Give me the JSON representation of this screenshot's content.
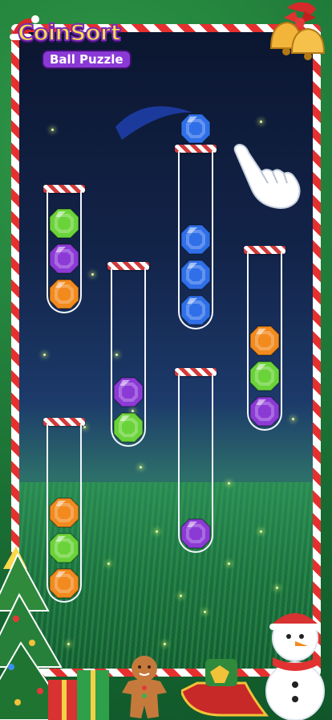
{
  "game": {
    "logo_title": "CoinSort",
    "logo_subtitle": "Ball Puzzle"
  },
  "colors": {
    "green_gem": "#6bd33a",
    "purple_gem": "#8c3ad6",
    "orange_gem": "#f28a1e",
    "blue_gem": "#2f6fe8"
  },
  "held_gem": {
    "color": "blue"
  },
  "tubes": [
    {
      "id": "tube-1",
      "gems_top_to_bottom": [
        "green",
        "purple",
        "orange"
      ]
    },
    {
      "id": "tube-2",
      "gems_top_to_bottom": [
        "purple",
        "green"
      ]
    },
    {
      "id": "tube-3",
      "gems_top_to_bottom": [
        "blue",
        "blue",
        "blue"
      ]
    },
    {
      "id": "tube-4",
      "gems_top_to_bottom": [
        "orange",
        "green",
        "purple"
      ]
    },
    {
      "id": "tube-5",
      "gems_top_to_bottom": [
        "orange",
        "green",
        "orange"
      ]
    },
    {
      "id": "tube-6",
      "gems_top_to_bottom": [
        "purple"
      ]
    }
  ],
  "icons": [
    "santa-hat-icon",
    "christmas-bells-icon",
    "pointing-hand-icon",
    "christmas-tree-icon",
    "snowman-icon",
    "gingerbread-man-icon",
    "sleigh-icon",
    "gift-boxes-icon"
  ]
}
